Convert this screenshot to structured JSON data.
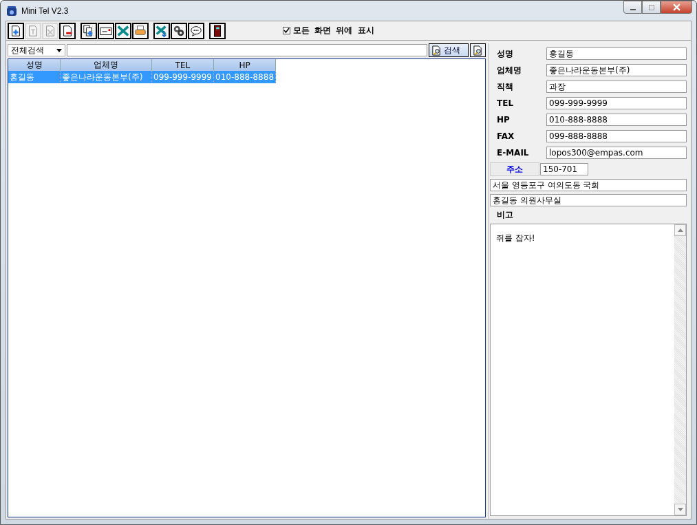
{
  "window": {
    "title": "Mini Tel V2.3"
  },
  "toolbar": {
    "groups": [
      [
        {
          "disabled": false
        },
        {
          "disabled": true
        },
        {
          "disabled": true
        },
        {
          "disabled": false
        }
      ],
      [
        {
          "disabled": false
        },
        {
          "disabled": false
        },
        {
          "disabled": false
        },
        {
          "disabled": false
        }
      ],
      [
        {
          "disabled": false
        },
        {
          "disabled": false
        },
        {
          "disabled": false
        }
      ],
      [
        {
          "disabled": false
        }
      ]
    ],
    "always_on_top": {
      "label": "모든 화면 위에 표시",
      "checked": true
    }
  },
  "search": {
    "scope": "전체검색",
    "button_label": "검색"
  },
  "table": {
    "columns": [
      "성명",
      "업체명",
      "TEL",
      "HP"
    ],
    "rows": [
      {
        "cells": [
          "홍길동",
          "좋은나라운동본부(주)",
          "099-999-9999",
          "010-888-8888"
        ],
        "selected": true
      }
    ]
  },
  "details": {
    "fields": [
      {
        "label": "성명",
        "value": "홍길동"
      },
      {
        "label": "업체명",
        "value": "좋은나라운동본부(주)"
      },
      {
        "label": "직책",
        "value": "과장"
      },
      {
        "label": "TEL",
        "value": "099-999-9999"
      },
      {
        "label": "HP",
        "value": "010-888-8888"
      },
      {
        "label": "FAX",
        "value": "099-888-8888"
      },
      {
        "label": "E-MAIL",
        "value": "lopos300@empas.com"
      }
    ],
    "address": {
      "button_label": "주소",
      "zip": "150-701",
      "line1": "서울 영등포구 여의도동 국회",
      "line2": "홍길동 의원사무실"
    },
    "memo": {
      "label": "비고",
      "text": "쥐를 잡자!"
    }
  }
}
